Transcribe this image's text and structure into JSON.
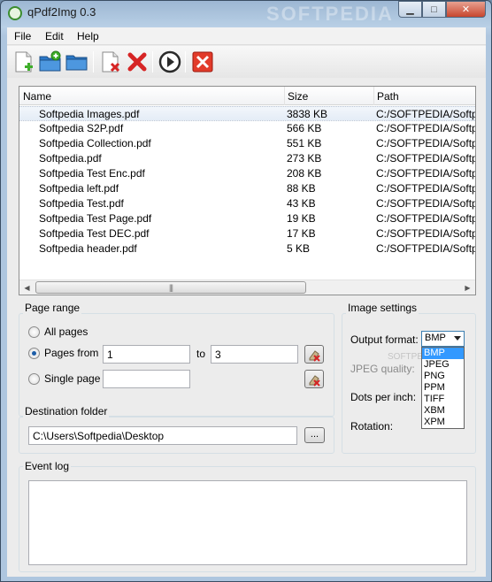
{
  "window": {
    "title": "qPdf2Img 0.3",
    "watermark": "SOFTPEDIA",
    "minimize": "▁",
    "maximize": "□",
    "close": "✕"
  },
  "menu": [
    "File",
    "Edit",
    "Help"
  ],
  "toolbar": {
    "buttons": [
      "add-file-icon",
      "add-folder-icon",
      "open-folder-icon",
      "remove-file-icon",
      "remove-all-icon",
      "start-conversion-icon",
      "stop-icon"
    ]
  },
  "file_list": {
    "columns": [
      "Name",
      "Size",
      "Path"
    ],
    "rows": [
      {
        "name": "Softpedia Images.pdf",
        "size": "3838 KB",
        "path": "C:/SOFTPEDIA/Softpe"
      },
      {
        "name": "Softpedia S2P.pdf",
        "size": "566 KB",
        "path": "C:/SOFTPEDIA/Softpe"
      },
      {
        "name": "Softpedia Collection.pdf",
        "size": "551 KB",
        "path": "C:/SOFTPEDIA/Softpe"
      },
      {
        "name": "Softpedia.pdf",
        "size": "273 KB",
        "path": "C:/SOFTPEDIA/Softpe"
      },
      {
        "name": "Softpedia Test Enc.pdf",
        "size": "208 KB",
        "path": "C:/SOFTPEDIA/Softpe"
      },
      {
        "name": "Softpedia left.pdf",
        "size": "88 KB",
        "path": "C:/SOFTPEDIA/Softpe"
      },
      {
        "name": "Softpedia Test.pdf",
        "size": "43 KB",
        "path": "C:/SOFTPEDIA/Softpe"
      },
      {
        "name": "Softpedia Test Page.pdf",
        "size": "19 KB",
        "path": "C:/SOFTPEDIA/Softpe"
      },
      {
        "name": "Softpedia Test DEC.pdf",
        "size": "17 KB",
        "path": "C:/SOFTPEDIA/Softpe"
      },
      {
        "name": "Softpedia header.pdf",
        "size": "5 KB",
        "path": "C:/SOFTPEDIA/Softpe"
      }
    ],
    "scroll_left": "◀",
    "scroll_right": "▶",
    "scroll_grip": "|||"
  },
  "page_range": {
    "title": "Page range",
    "all_pages": "All pages",
    "pages_from": "Pages from",
    "from_value": "1",
    "to_label": "to",
    "to_value": "3",
    "single_page": "Single page",
    "single_value": "",
    "selected": "pages_from"
  },
  "image_settings": {
    "title": "Image settings",
    "output_format_label": "Output format:",
    "output_format_value": "BMP",
    "jpeg_quality_label": "JPEG quality:",
    "dpi_label": "Dots per inch:",
    "rotation_label": "Rotation:",
    "format_options": [
      "BMP",
      "JPEG",
      "PNG",
      "PPM",
      "TIFF",
      "XBM",
      "XPM"
    ],
    "watermark": "SOFTPEDIA"
  },
  "destination": {
    "title": "Destination folder",
    "path": "C:\\Users\\Softpedia\\Desktop",
    "browse": "..."
  },
  "event_log": {
    "title": "Event log"
  }
}
